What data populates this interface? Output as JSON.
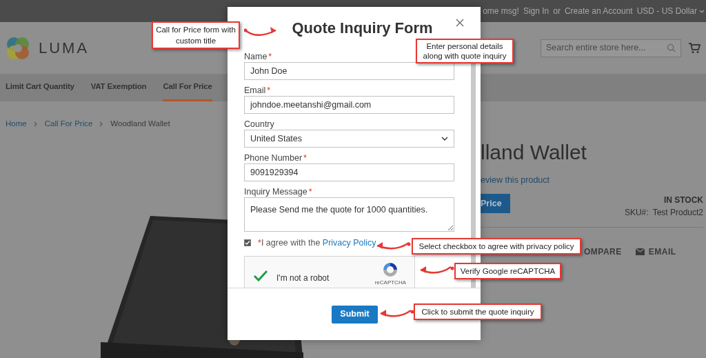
{
  "top_bar": {
    "welcome": "ome msg!",
    "links": [
      "Sign In",
      "or",
      "Create an Account"
    ],
    "currency": "USD - US Dollar"
  },
  "header": {
    "logo_text": "LUMA",
    "search": {
      "placeholder": "Search entire store here..."
    }
  },
  "nav": [
    {
      "label": "Limit Cart Quantity",
      "selected": false
    },
    {
      "label": "VAT Exemption",
      "selected": false
    },
    {
      "label": "Call For Price",
      "selected": true
    }
  ],
  "breadcrumbs": [
    "Home",
    "Call For Price",
    "Woodland Wallet"
  ],
  "product": {
    "title": "lland Wallet",
    "review_link": "eview this product",
    "price_button": "Price",
    "stock": "IN STOCK",
    "sku_label": "SKU#:",
    "sku": "Test Product2",
    "actions": [
      "OMPARE",
      "EMAIL"
    ]
  },
  "modal": {
    "title": "Quote Inquiry Form",
    "fields": [
      {
        "label": "Name",
        "marker": "*",
        "kind": "text",
        "value": "John Doe"
      },
      {
        "label": "Email",
        "marker": "*",
        "kind": "text",
        "value": "johndoe.meetanshi@gmail.com"
      },
      {
        "label": "Country",
        "kind": "select",
        "value": "United States"
      },
      {
        "label": "Phone Number",
        "marker": "*",
        "kind": "text",
        "value": "9091929394"
      },
      {
        "label": "Inquiry Message",
        "marker": "*",
        "kind": "textarea",
        "value": "Please Send me the quote for 1000 quantities."
      }
    ],
    "agreement": {
      "checked": true,
      "marker": "*",
      "text": "I agree with the ",
      "link": "Privacy Policy"
    },
    "captcha": {
      "label": "I'm not a robot",
      "brand": "reCAPTCHA",
      "verified": true
    },
    "submit": "Submit"
  },
  "annotations": [
    {
      "text": "Call for Price form with custom title"
    },
    {
      "text": "Enter personal details along with quote inquiry"
    },
    {
      "text": "Select checkbox to agree with privacy policy"
    },
    {
      "text": "Verify Google reCAPTCHA"
    },
    {
      "text": "Click to submit the quote inquiry"
    }
  ]
}
